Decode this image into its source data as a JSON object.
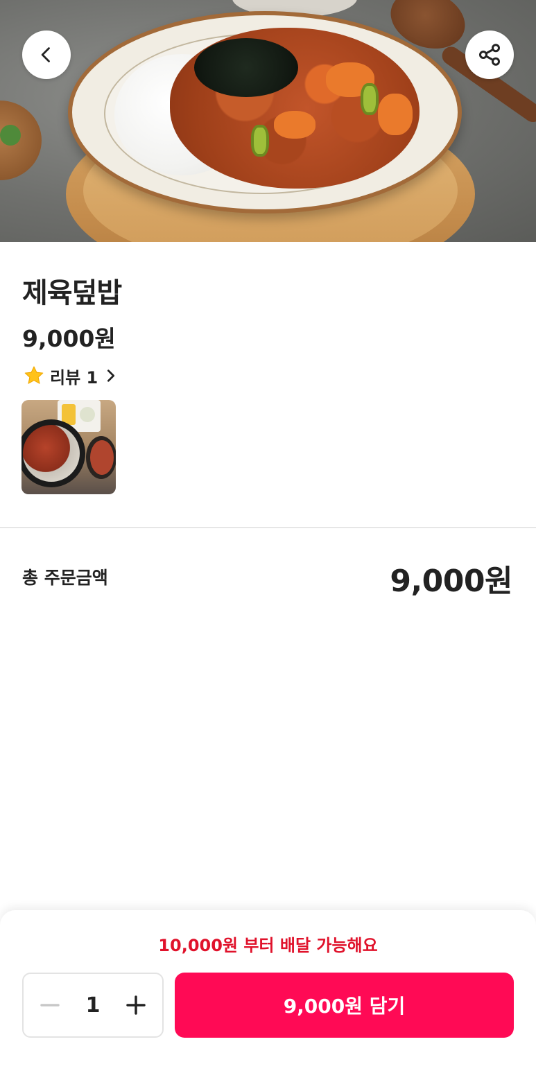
{
  "product": {
    "name": "제육덮밥",
    "price": "9,000원",
    "image_description_icon": "food-photo"
  },
  "reviews": {
    "icon": "star-icon",
    "label": "리뷰 1"
  },
  "order": {
    "total_label": "총 주문금액",
    "total_value": "9,000원"
  },
  "bottom_bar": {
    "min_order_notice": "10,000원 부터 배달 가능해요",
    "quantity": "1",
    "add_button_label": "9,000원 담기"
  },
  "colors": {
    "accent": "#ff0a55",
    "notice": "#e0122b"
  },
  "icons": {
    "back": "chevron-left-icon",
    "share": "share-icon",
    "review_more": "chevron-right-icon",
    "decrease": "minus-icon",
    "increase": "plus-icon"
  }
}
